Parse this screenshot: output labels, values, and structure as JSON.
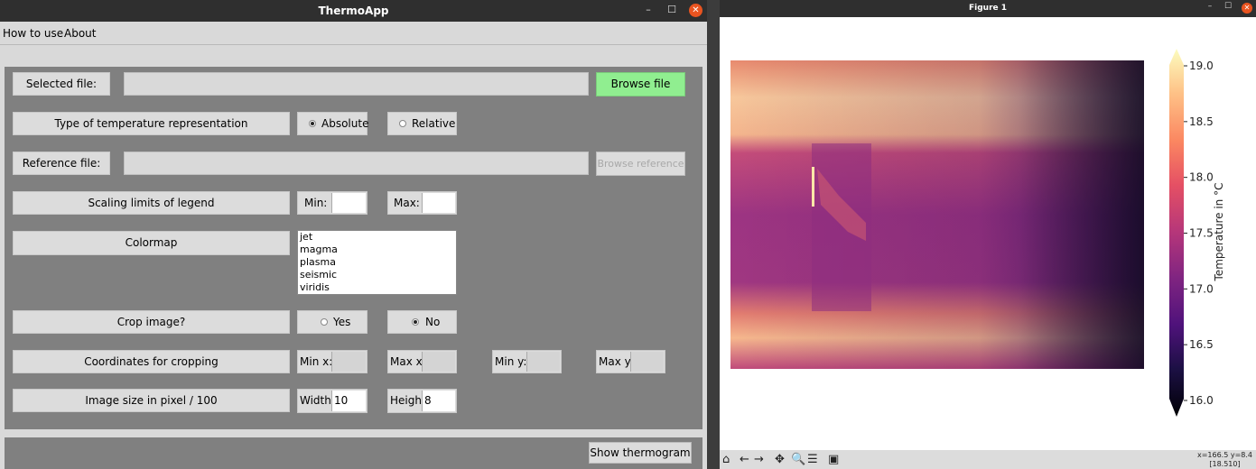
{
  "left_window": {
    "title": "ThermoApp",
    "menu": [
      "How to use",
      "About"
    ],
    "selected_file": {
      "label": "Selected file:",
      "value": "",
      "button": "Browse file"
    },
    "representation": {
      "label": "Type of temperature representation",
      "options": [
        "Absolute",
        "Relative"
      ],
      "selected": "Absolute"
    },
    "reference_file": {
      "label": "Reference file:",
      "value": "",
      "button": "Browse reference"
    },
    "scaling": {
      "label": "Scaling limits of legend",
      "min_label": "Min:",
      "min_value": "",
      "max_label": "Max:",
      "max_value": ""
    },
    "colormap": {
      "label": "Colormap",
      "options": [
        "jet",
        "magma",
        "plasma",
        "seismic",
        "viridis"
      ]
    },
    "crop": {
      "label": "Crop image?",
      "options": [
        "Yes",
        "No"
      ],
      "selected": "No"
    },
    "coordinates": {
      "label": "Coordinates for cropping",
      "min_x": "Min x:",
      "max_x": "Max x:",
      "min_y": "Min y:",
      "max_y": "Max y:"
    },
    "image_size": {
      "label": "Image size in pixel / 100",
      "width_label": "Width:",
      "width_value": "10",
      "height_label": "Height:",
      "height_value": "8"
    },
    "show_button": "Show thermogram"
  },
  "right_window": {
    "title": "Figure 1",
    "colorbar": {
      "label": "Temperature in °C",
      "ticks": [
        "19.0",
        "18.5",
        "18.0",
        "17.5",
        "17.0",
        "16.5",
        "16.0"
      ],
      "colormap": "magma"
    },
    "coords_line1": "x=166.5 y=8.4",
    "coords_line2": "[18.510]"
  },
  "colors": {
    "titlebar": "#2f2f2f",
    "close": "#e95420",
    "panel": "#808080",
    "browse_green": "#90ee90",
    "magma_low": "#000004",
    "magma_high": "#fcfdbf"
  }
}
